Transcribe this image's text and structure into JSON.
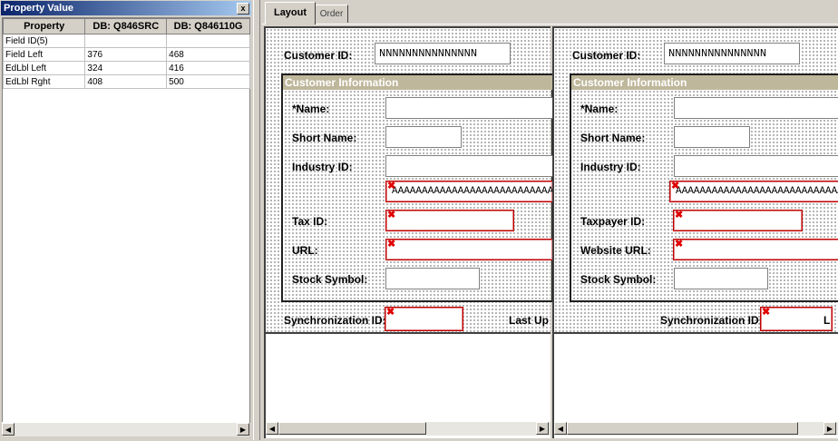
{
  "property_panel": {
    "title": "Property Value",
    "close_glyph": "x",
    "columns": [
      "Property",
      "DB: Q846SRC",
      "DB: Q846110G"
    ],
    "rows": [
      [
        "Field ID(5)",
        "",
        ""
      ],
      [
        "Field Left",
        "376",
        "468"
      ],
      [
        "EdLbl Left",
        "324",
        "416"
      ],
      [
        "EdLbl Rght",
        "408",
        "500"
      ]
    ]
  },
  "tabs": [
    {
      "label": "Layout",
      "active": true
    },
    {
      "label": "Order",
      "active": false
    }
  ],
  "pane_left": {
    "customer_id_label": "Customer ID:",
    "customer_id_value": "NNNNNNNNNNNNNNN",
    "group_title": "Customer Information",
    "name_label": "*Name:",
    "short_name_label": "Short Name:",
    "industry_id_label": "Industry ID:",
    "industry_value": "AAAAAAAAAAAAAAAAAAAAAAAAAAAAAAAA",
    "tax_id_label": "Tax ID:",
    "url_label": "URL:",
    "stock_symbol_label": "Stock Symbol:",
    "sync_id_label": "Synchronization ID:",
    "last_label": "Last Up"
  },
  "pane_right": {
    "customer_id_label": "Customer ID:",
    "customer_id_value": "NNNNNNNNNNNNNNN",
    "group_title": "Customer Information",
    "name_label": "*Name:",
    "short_name_label": "Short Name:",
    "industry_id_label": "Industry ID:",
    "industry_value": "AAAAAAAAAAAAAAAAAAAAAAAAAAAAAAAA",
    "tax_id_label": "Taxpayer ID:",
    "url_label": "Website URL:",
    "stock_symbol_label": "Stock Symbol:",
    "sync_id_label": "Synchronization ID:",
    "last_label": "L"
  },
  "icons": {
    "close": "close-icon",
    "error_marker": "error-x-icon",
    "scroll_left": "scroll-left-arrow-icon",
    "scroll_right": "scroll-right-arrow-icon"
  },
  "colors": {
    "titlebar_start": "#0a246a",
    "titlebar_end": "#a6caf0",
    "group_header": "#bfb79b",
    "error_red": "#e00000"
  },
  "glyphs": {
    "error_x": "✖",
    "arrow_left": "◀",
    "arrow_right": "▶"
  }
}
